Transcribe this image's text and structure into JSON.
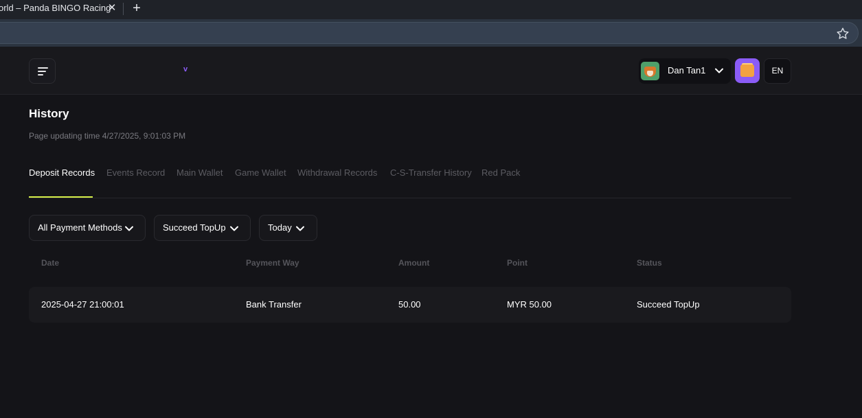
{
  "browser": {
    "tab_title": "orld – Panda BINGO Racing",
    "tab_close": "✕",
    "new_tab": "+"
  },
  "header": {
    "logo_mark": "v",
    "user": {
      "name": "Dan Tan1"
    },
    "language": "EN",
    "accent_color": "#8b5cf6"
  },
  "page": {
    "title": "History",
    "update_time": "Page updating time 4/27/2025, 9:01:03 PM"
  },
  "tabs": [
    {
      "label": "Deposit Records",
      "active": true
    },
    {
      "label": "Events Record",
      "active": false
    },
    {
      "label": "Main Wallet",
      "active": false
    },
    {
      "label": "Game Wallet",
      "active": false
    },
    {
      "label": "Withdrawal Records",
      "active": false
    },
    {
      "label": "C-S-Transfer History",
      "active": false
    },
    {
      "label": "Red Pack",
      "active": false
    }
  ],
  "tab_underline_color": "#d7f04a",
  "filters": {
    "payment_method": "All Payment Methods",
    "status": "Succeed TopUp",
    "period": "Today"
  },
  "table": {
    "headers": [
      "Date",
      "Payment Way",
      "Amount",
      "Point",
      "Status"
    ],
    "rows": [
      [
        "2025-04-27 21:00:01",
        "Bank Transfer",
        "50.00",
        "MYR 50.00",
        "Succeed TopUp"
      ]
    ]
  }
}
